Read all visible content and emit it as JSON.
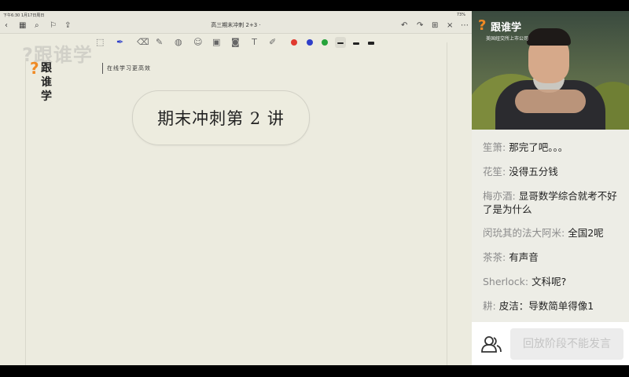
{
  "status": {
    "time": "下午6:30  1月17日周日",
    "battery": "73%"
  },
  "nav": {
    "title": "高三期末冲刺 2+3 ·"
  },
  "watermark": {
    "text": "?跟谁学"
  },
  "logo": {
    "mark": "?",
    "name": "跟谁学",
    "tagline": "在线学习更高效"
  },
  "lecture": {
    "title": "期末冲刺第 2 讲"
  },
  "toolbar": {
    "tools": [
      "lasso-icon",
      "pen-icon",
      "eraser-icon",
      "highlighter-icon",
      "shapes-icon",
      "sticker-icon",
      "image-icon",
      "camera-icon",
      "text-icon",
      "brush-icon"
    ],
    "colors": [
      "#e03a2f",
      "#2f3fc9",
      "#25a33a"
    ]
  },
  "video": {
    "logo_name": "跟谁学",
    "logo_sub": "美国纽交所上市公司"
  },
  "chat": {
    "messages": [
      {
        "user": "笙箫:",
        "text": " 那完了吧。。。"
      },
      {
        "user": "花笙:",
        "text": " 没得五分钱"
      },
      {
        "user": "梅亦酒:",
        "text": " 显哥数学综合就考不好了是为什么"
      },
      {
        "user": "闵玧其的法大阿米:",
        "text": " 全国2呢"
      },
      {
        "user": "茶茶:",
        "text": " 有声音"
      },
      {
        "user": "Sherlock:",
        "text": " 文科呢?"
      },
      {
        "user": "耕:",
        "text": " 皮洁：导数简单得像1"
      }
    ]
  },
  "input": {
    "placeholder": "回放阶段不能发言"
  }
}
